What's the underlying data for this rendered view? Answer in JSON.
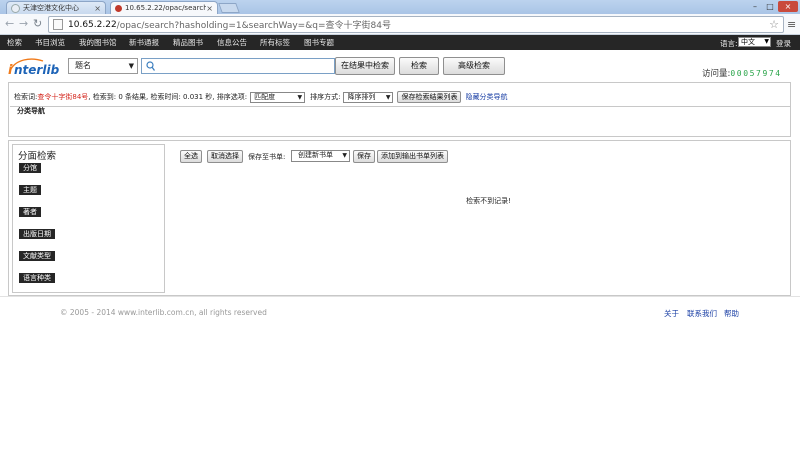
{
  "browser": {
    "tabs": [
      {
        "label": "天津空港文化中心",
        "active": false
      },
      {
        "label": "10.65.2.22/opac/search",
        "active": true
      }
    ],
    "url_host": "10.65.2.22",
    "url_rest": "/opac/search?hasholding=1&searchWay=&q=查令十字街84号"
  },
  "nav": {
    "items": [
      "检索",
      "书目浏览",
      "我的图书馆",
      "新书通报",
      "精品图书",
      "信息公告",
      "所有标签",
      "图书专题"
    ],
    "language_label": "语言:",
    "language_value": "中文",
    "login": "登录"
  },
  "search": {
    "field_select": "题名",
    "query": "",
    "btn_in_results": "在结果中检索",
    "btn_search": "检索",
    "btn_advanced": "高级检索",
    "visits_label": "访问量:",
    "visits_count": "00057974"
  },
  "info": {
    "term_label": "检索词:",
    "term_value": "查令十字街84号",
    "found_text": ", 检索到: 0 条结果, 检索时间: 0.031 秒, 排序选项:",
    "sort_option": "匹配度",
    "sort_mode_label": "排序方式:",
    "sort_mode": "降序排列",
    "save_results": "保存检索结果列表",
    "hide_nav": "隐藏分类导航"
  },
  "catnav": {
    "title": "分类导航"
  },
  "facets": {
    "title": "分面检索",
    "items": [
      "分馆",
      "主题",
      "著者",
      "出版日期",
      "文献类型",
      "语言种类"
    ]
  },
  "actions": {
    "select_all": "全选",
    "deselect": "取消选择",
    "save_to_label": "保存至书单:",
    "booklist_select": "创建新书单",
    "save": "保存",
    "add_to_output": "添加到输出书单列表"
  },
  "results": {
    "empty_text": "检索不到记录!"
  },
  "footer": {
    "copyright": "© 2005 - 2014 www.interlib.com.cn, all rights reserved",
    "links": [
      "关于",
      "联系我们",
      "帮助"
    ]
  },
  "colors": {
    "nav_bg": "#262626",
    "accent_red": "#d4261d",
    "link_blue": "#1a3fa5",
    "counter_green": "#2aa44a",
    "logo_orange": "#f07a1a"
  }
}
